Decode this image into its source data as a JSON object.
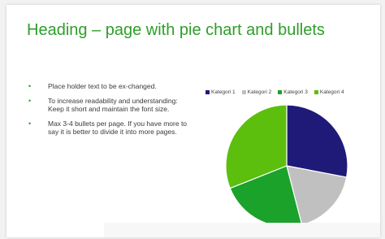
{
  "slide": {
    "title": "Heading – page with pie chart and bullets",
    "bullets": [
      "Place holder text to be ex-changed.",
      "To increase readability and understanding: Keep it short and maintain the font size.",
      "Max 3-4 bullets per page. If you have more to say it is better to divide it into more pages."
    ],
    "bullet_glyph": "•"
  },
  "colors": {
    "title": "#2e9e2a",
    "kategori_1": "#1f1a78",
    "kategori_2": "#c0c0c0",
    "kategori_3": "#1aa22a",
    "kategori_4": "#5cbf0d"
  },
  "chart_data": {
    "type": "pie",
    "title": "",
    "legend_position": "top",
    "categories": [
      "Kategori 1",
      "Kategori 2",
      "Kategori 3",
      "Kategori 4"
    ],
    "values": [
      28,
      18,
      23,
      31
    ],
    "colors": [
      "#1f1a78",
      "#c0c0c0",
      "#1aa22a",
      "#5cbf0d"
    ]
  }
}
